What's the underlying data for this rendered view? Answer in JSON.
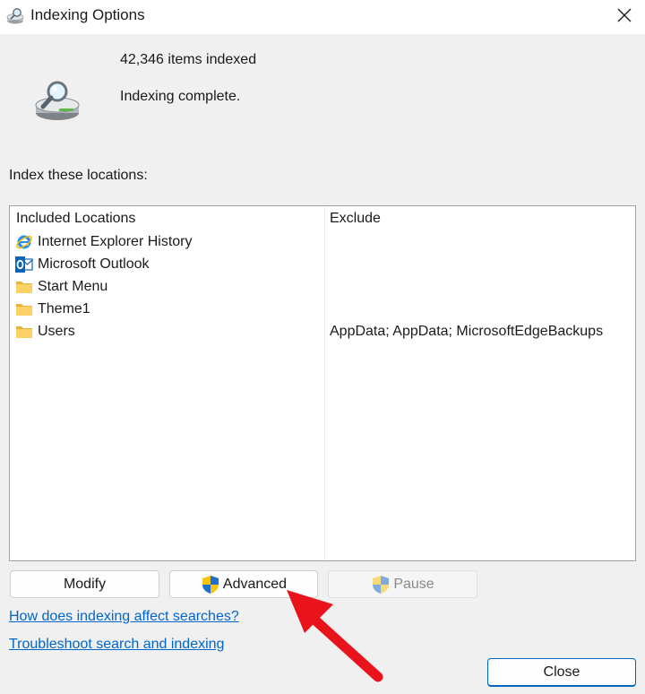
{
  "window": {
    "title": "Indexing Options",
    "app_icon": "indexing-options-icon",
    "close_icon": "close-icon"
  },
  "status": {
    "icon": "hard-drive-magnifier-icon",
    "items_indexed": "42,346 items indexed",
    "state": "Indexing complete."
  },
  "locations": {
    "label": "Index these locations:",
    "columns": {
      "included": "Included Locations",
      "exclude": "Exclude"
    },
    "rows": [
      {
        "name": "Internet Explorer History",
        "exclude": "",
        "icon": "internet-explorer-icon"
      },
      {
        "name": "Microsoft Outlook",
        "exclude": "",
        "icon": "outlook-icon"
      },
      {
        "name": "Start Menu",
        "exclude": "",
        "icon": "folder-icon"
      },
      {
        "name": "Theme1",
        "exclude": "",
        "icon": "folder-icon"
      },
      {
        "name": "Users",
        "exclude": "AppData; AppData; MicrosoftEdgeBackups",
        "icon": "folder-icon"
      }
    ]
  },
  "buttons": {
    "modify": "Modify",
    "advanced": "Advanced",
    "pause": "Pause",
    "close": "Close"
  },
  "links": {
    "how_affects": "How does indexing affect searches?",
    "troubleshoot": "Troubleshoot search and indexing"
  },
  "colors": {
    "link": "#0066cc",
    "annotation_arrow": "#e8131b",
    "close_button_border": "#0067c0"
  }
}
